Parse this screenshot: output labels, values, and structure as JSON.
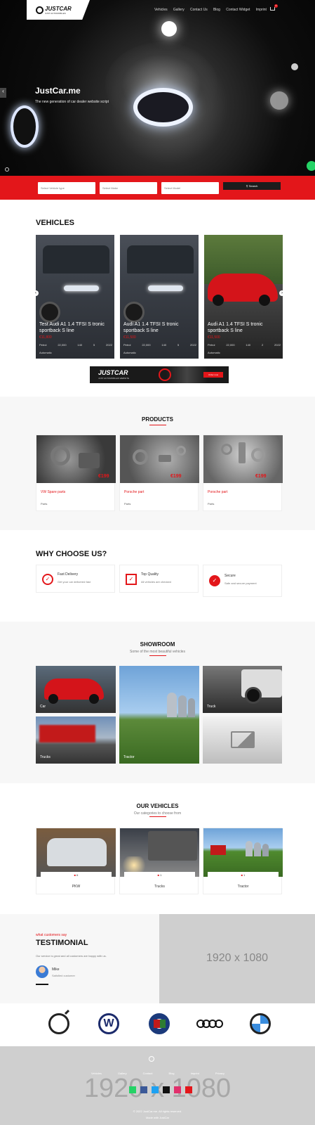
{
  "header": {
    "logo_text": "JUSTCAR",
    "logo_sub": "JUST AUTOMOBILES",
    "nav": [
      "Vehicles",
      "Gallery",
      "Contact Us",
      "Blog",
      "Contact Widget",
      "Imprint"
    ],
    "cart_count": "0"
  },
  "hero": {
    "title": "JustCar.me",
    "subtitle": "The new generation of car dealer website script",
    "prev_icon": "chevron-left",
    "chat_icon": "chat-bubble"
  },
  "search": {
    "field1": "Select Vehicle type",
    "field2": "Select Make",
    "field3": "Select Model",
    "button": "Search"
  },
  "vehicles": {
    "title": "VEHICLES",
    "items": [
      {
        "name": "Test Audi A1 1.4 TFSI S tronic sportback S line",
        "price": "€11,800",
        "specs": [
          "Petrol",
          "22,000",
          "140",
          "5",
          "2022"
        ],
        "badge": "Automatic"
      },
      {
        "name": "Audi A1 1.4 TFSI S tronic sportback S line",
        "price": "€11,500",
        "specs": [
          "Petrol",
          "22,000",
          "140",
          "5",
          "2022"
        ],
        "badge": "Automatic"
      },
      {
        "name": "Audi A1 1.4 TFSI S tronic sportback S line",
        "price": "€11,500",
        "specs": [
          "Petrol",
          "22,000",
          "140",
          "2",
          "2022"
        ],
        "badge": "Automatic"
      }
    ],
    "banner_logo": "JUSTCAR",
    "banner_sub": "JUST AUTOMOBILES WEBSITE",
    "banner_button": "Order now"
  },
  "products": {
    "title": "PRODUCTS",
    "items": [
      {
        "name": "VW Spare parts",
        "price": "€199",
        "meta": "Parts"
      },
      {
        "name": "Porsche part",
        "price": "€199",
        "meta": "Parts"
      },
      {
        "name": "Porsche part",
        "price": "€199",
        "meta": "Parts"
      }
    ]
  },
  "why": {
    "title": "WHY CHOOSE US?",
    "items": [
      {
        "title": "Fast Delivery",
        "text": "Get your car delivered fast"
      },
      {
        "title": "Top Quality",
        "text": "All vehicles are checked"
      },
      {
        "title": "Secure",
        "text": "Safe and secure payment"
      }
    ]
  },
  "showroom": {
    "title": "SHOWROOM",
    "subtitle": "Some of the most beautiful vehicles",
    "tiles": [
      "Car",
      "Truck",
      "Trucks",
      "Tractor",
      ""
    ]
  },
  "our_vehicles": {
    "title": "OUR VEHICLES",
    "subtitle": "Our categories to choose from",
    "items": [
      {
        "name": "PKW",
        "count": "6"
      },
      {
        "name": "Trucks",
        "count": "1"
      },
      {
        "name": "Tractor",
        "count": "1"
      }
    ]
  },
  "testimonial": {
    "kicker": "what customers say",
    "title": "TESTIMONIAL",
    "quote": "Our service is great and all customers are happy with us.",
    "author": "Mike",
    "role": "Satisfied customer",
    "placeholder": "1920 x 1080"
  },
  "brands": [
    "Volvo",
    "Volkswagen",
    "Alfa Romeo",
    "Audi",
    "BMW"
  ],
  "footer": {
    "placeholder": "1920 x 1080",
    "links": [
      "Vehicles",
      "Gallery",
      "Contact",
      "Blog",
      "Imprint",
      "Privacy"
    ],
    "copyright": "© 2022 JustCar.me. All rights reserved.",
    "sub": "Made with JustCar",
    "colors": {
      "whatsapp": "#25d366",
      "facebook": "#3b5998",
      "twitter": "#1da1f2",
      "tiktok": "#111111",
      "instagram": "#e1306c",
      "youtube": "#e3161a"
    }
  },
  "colors": {
    "accent": "#e3161a",
    "dark": "#111111",
    "light_bg": "#f7f7f7"
  }
}
